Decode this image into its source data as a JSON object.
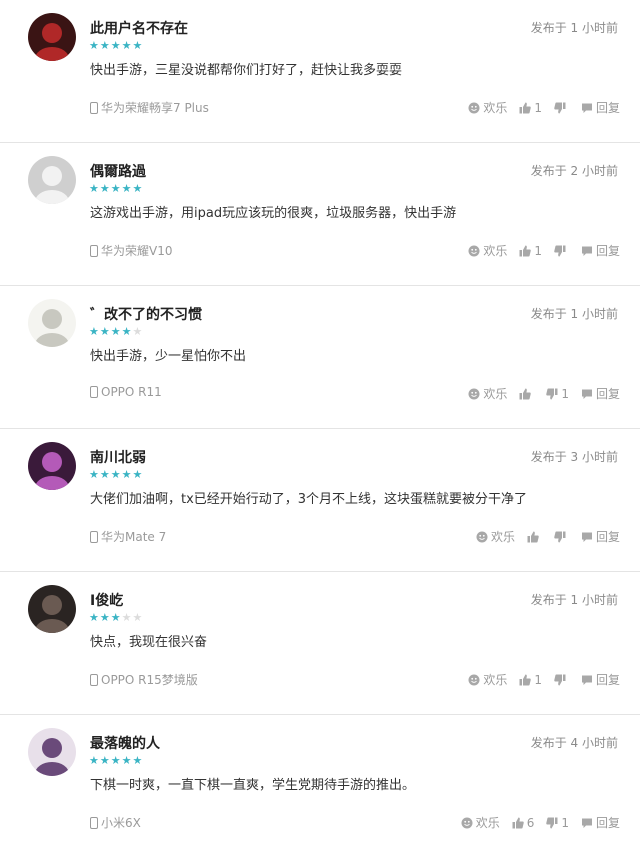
{
  "comments": [
    {
      "username": "此用户名不存在",
      "time": "发布于 1 小时前",
      "rating": 5,
      "content": "快出手游，三星没说都帮你们打好了，赶快让我多耍耍",
      "device": "华为荣耀畅享7 Plus",
      "fun_label": "欢乐",
      "likes": "1",
      "dislikes": "",
      "reply_label": "回复",
      "avatar": {
        "bg": "#3a1414",
        "fg": "#b02828"
      }
    },
    {
      "username": "偶爾路過",
      "time": "发布于 2 小时前",
      "rating": 5,
      "content": "这游戏出手游，用ipad玩应该玩的很爽，垃圾服务器，快出手游",
      "device": "华为荣耀V10",
      "fun_label": "欢乐",
      "likes": "1",
      "dislikes": "",
      "reply_label": "回复",
      "avatar": {
        "bg": "#cfcfcf",
        "fg": "#f2f2f2"
      }
    },
    {
      "username": "゛改不了的不习惯",
      "time": "发布于 1 小时前",
      "rating": 4,
      "content": "快出手游，少一星怕你不出",
      "device": "OPPO R11",
      "fun_label": "欢乐",
      "likes": "",
      "dislikes": "1",
      "reply_label": "回复",
      "avatar": {
        "bg": "#f4f4f0",
        "fg": "#c8c8c0"
      }
    },
    {
      "username": "南川北弱",
      "time": "发布于 3 小时前",
      "rating": 5,
      "content": "大佬们加油啊，tx已经开始行动了，3个月不上线，这块蛋糕就要被分干净了",
      "device": "华为Mate 7",
      "fun_label": "欢乐",
      "likes": "",
      "dislikes": "",
      "reply_label": "回复",
      "avatar": {
        "bg": "#3a1a3a",
        "fg": "#b45ab8"
      }
    },
    {
      "username": "I俊屹",
      "time": "发布于 1 小时前",
      "rating": 3,
      "content": "快点，我现在很兴奋",
      "device": "OPPO R15梦境版",
      "fun_label": "欢乐",
      "likes": "1",
      "dislikes": "",
      "reply_label": "回复",
      "avatar": {
        "bg": "#2a2422",
        "fg": "#6a5a52"
      }
    },
    {
      "username": "最落魄的人",
      "time": "发布于 4 小时前",
      "rating": 5,
      "content": "下棋一时爽，一直下棋一直爽，学生党期待手游的推出。",
      "device": "小米6X",
      "fun_label": "欢乐",
      "likes": "6",
      "dislikes": "1",
      "reply_label": "回复",
      "avatar": {
        "bg": "#e8e0ea",
        "fg": "#6a4a7a"
      }
    }
  ],
  "colors": {
    "star_on": "#3ab4c4",
    "star_off": "#dcdcdc",
    "meta_text": "#9a9a9a"
  }
}
